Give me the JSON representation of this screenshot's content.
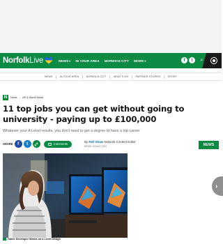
{
  "brand": {
    "name_bold": "Norfolk",
    "name_light": "Live"
  },
  "nav": {
    "items": [
      {
        "label": "NEWS",
        "caret": "▾"
      },
      {
        "label": "IN YOUR AREA",
        "caret": ""
      },
      {
        "label": "NORWICH CITY",
        "caret": ""
      },
      {
        "label": "MORE",
        "caret": "▾"
      }
    ]
  },
  "social": {
    "facebook": "f",
    "twitter": "t",
    "search": "⌕"
  },
  "subnav": {
    "items": [
      "NEWS",
      "IN YOUR AREA",
      "NORWICH CITY",
      "WHAT'S ON",
      "PARTNER STORIES",
      "SPORT"
    ]
  },
  "breadcrumb": {
    "icon": "N",
    "items": [
      "News",
      "UK & World News"
    ],
    "sep": "›"
  },
  "article": {
    "headline": "11 top jobs you can get without going to university - paying up to £100,000",
    "standfirst": "Whatever your A Level results, you don't need to get a degree to have a top career",
    "share_label": "SHARE",
    "comments_label": "Comments",
    "byline_prefix": "By",
    "author": "Neil Shaw",
    "author_role": "Network Content Editor",
    "date": "NEWS, 18 AUG 2022",
    "tag": "NEWS",
    "image_caption": "Game Developer Works on a Level Design"
  },
  "colors": {
    "brand_green": "#0a8a43",
    "dark": "#1a1a1a"
  },
  "icons": [
    "ukraine-heart-icon",
    "facebook-icon",
    "twitter-icon",
    "search-icon",
    "account-icon",
    "comments-icon",
    "camera-icon",
    "chevron-right-icon"
  ]
}
